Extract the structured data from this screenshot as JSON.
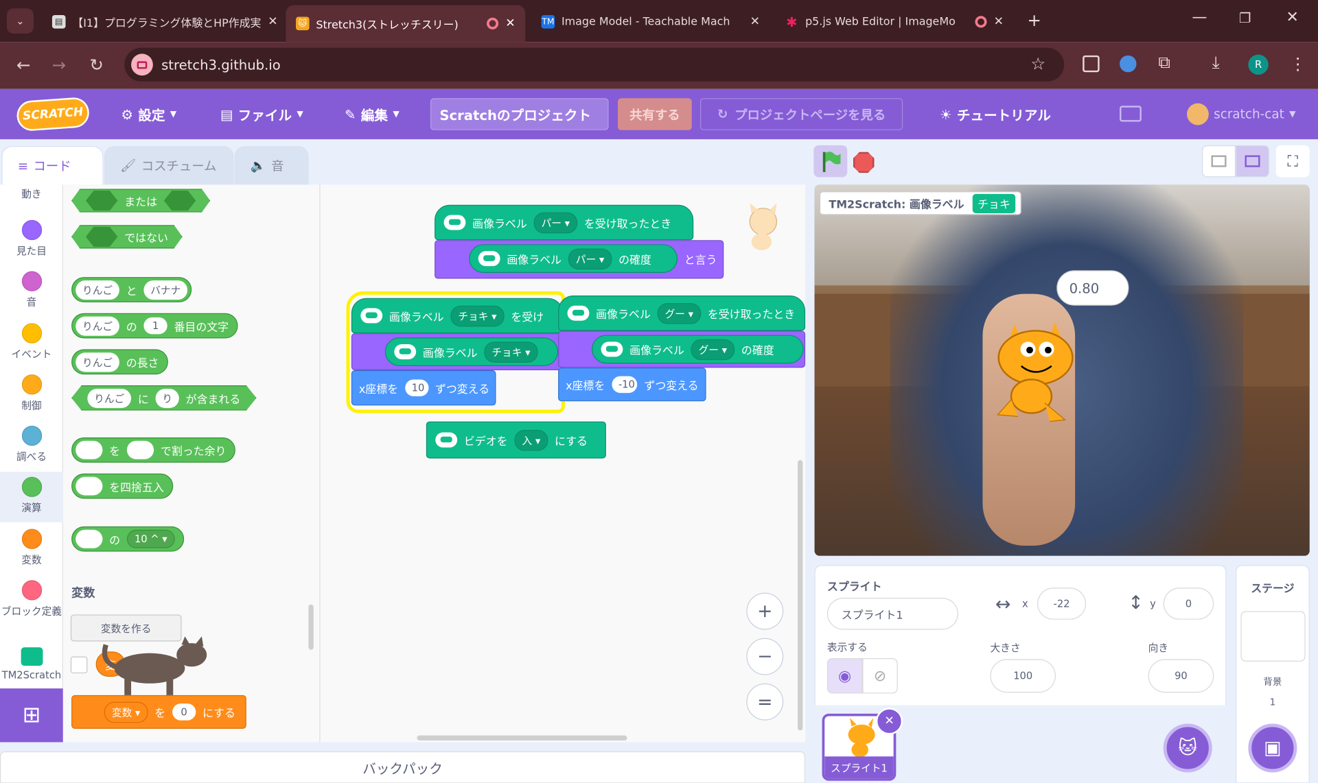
{
  "browser": {
    "tabs": [
      {
        "title": "【I1】プログラミング体験とHP作成実"
      },
      {
        "title": "Stretch3(ストレッチスリー)"
      },
      {
        "title": "Image Model - Teachable Mach"
      },
      {
        "title": "p5.js Web Editor | ImageMo"
      }
    ],
    "new_tab": "+",
    "url": "stretch3.github.io",
    "profile": "R"
  },
  "menu": {
    "logo": "SCRATCH",
    "settings": "設定",
    "file": "ファイル",
    "edit": "編集",
    "project_title": "Scratchのプロジェクト",
    "share": "共有する",
    "project_page": "プロジェクトページを見る",
    "tutorial": "チュートリアル",
    "user": "scratch-cat"
  },
  "editor_tabs": {
    "code": "コード",
    "costume": "コスチューム",
    "sound": "音"
  },
  "categories": [
    {
      "label": "動き",
      "color": "#4c97ff"
    },
    {
      "label": "見た目",
      "color": "#9966ff"
    },
    {
      "label": "音",
      "color": "#cf63cf"
    },
    {
      "label": "イベント",
      "color": "#ffbf00"
    },
    {
      "label": "制御",
      "color": "#ffab19"
    },
    {
      "label": "調べる",
      "color": "#5cb1d6"
    },
    {
      "label": "演算",
      "color": "#59c059"
    },
    {
      "label": "変数",
      "color": "#ff8c1a"
    },
    {
      "label": "ブロック定義",
      "color": "#ff6680"
    },
    {
      "label": "TM2Scratch",
      "color": "#0fbd8c"
    }
  ],
  "palette": {
    "or": "または",
    "not": "ではない",
    "join_a": "りんご",
    "join_mid": "と",
    "join_b": "バナナ",
    "letter_a": "りんご",
    "letter_mid": "の",
    "letter_n": "1",
    "letter_end": "番目の文字",
    "length_a": "りんご",
    "length_end": "の長さ",
    "contains_a": "りんご",
    "contains_mid": "に",
    "contains_b": "り",
    "contains_end": "が含まれる",
    "mod_mid": "を",
    "mod_end": "で割った余り",
    "round_end": "を四捨五入",
    "math_mid": "の",
    "math_fn": "10 ^",
    "var_heading": "変数",
    "make_var": "変数を作る",
    "var_chip": "変",
    "set_var": "変数",
    "set_mid": "を",
    "set_val": "0",
    "set_end": "にする"
  },
  "scripts": {
    "s1_hat": "画像ラベル",
    "s1_val": "パー",
    "s1_end": "を受け取ったとき",
    "s1_say_a": "画像ラベル",
    "s1_say_val": "パー",
    "s1_say_mid": "の確度",
    "s1_say_end": "と言う",
    "s2_hat": "画像ラベル",
    "s2_val": "チョキ",
    "s2_end": "を受け",
    "s2_inner": "画像ラベル",
    "s2_inner_val": "チョキ",
    "s2_move": "x座標を",
    "s2_move_val": "10",
    "s2_move_end": "ずつ変える",
    "s3_hat": "画像ラベル",
    "s3_val": "グー",
    "s3_end": "を受け取ったとき",
    "s3_inner": "画像ラベル",
    "s3_inner_val": "グー",
    "s3_inner_end": "の確度",
    "s3_move": "x座標を",
    "s3_move_val": "-10",
    "s3_move_end": "ずつ変える",
    "s4_video": "ビデオを",
    "s4_val": "入",
    "s4_end": "にする"
  },
  "zoom": {
    "in": "+",
    "out": "−",
    "reset": "="
  },
  "backpack": "バックパック",
  "stage": {
    "monitor_label": "TM2Scratch: 画像ラベル",
    "monitor_value": "チョキ",
    "speech": "0.80"
  },
  "sprite_info": {
    "heading": "スプライト",
    "name": "スプライト1",
    "x_label": "x",
    "x": "-22",
    "y_label": "y",
    "y": "0",
    "show_label": "表示する",
    "size_label": "大きさ",
    "size": "100",
    "direction_label": "向き",
    "direction": "90",
    "thumb_label": "スプライト1"
  },
  "stage_panel": {
    "heading": "ステージ",
    "backdrop_label": "背景",
    "backdrop_count": "1"
  }
}
